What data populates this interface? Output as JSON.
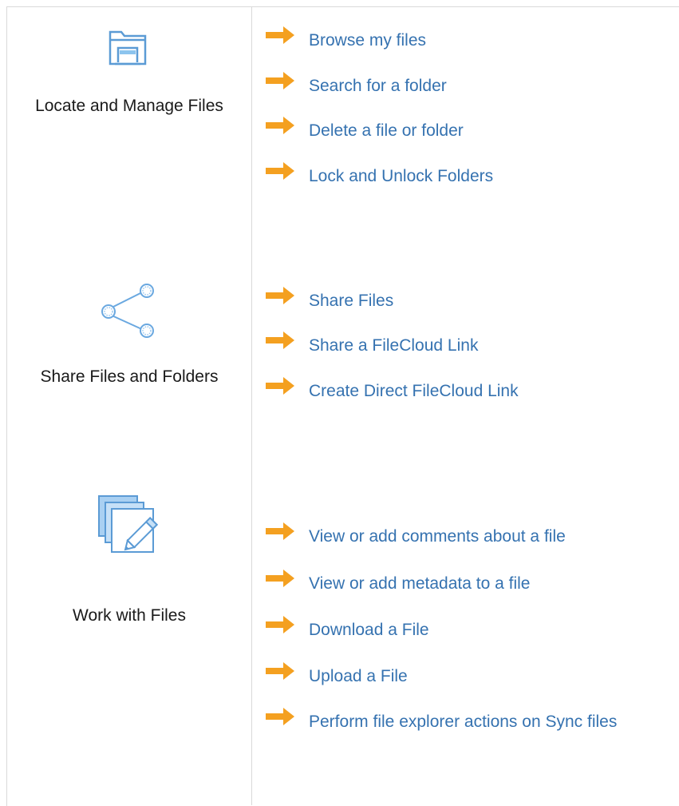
{
  "colors": {
    "link": "#3572b0",
    "arrow": "#f4a020",
    "icon": "#6aa8e0",
    "border": "#d9d9d9"
  },
  "sections": [
    {
      "title": "Locate and Manage Files",
      "icon": "folder-icon",
      "links": [
        "Browse my files",
        "Search for a folder",
        "Delete a file or folder",
        "Lock and Unlock Folders"
      ]
    },
    {
      "title": "Share Files and Folders",
      "icon": "share-icon",
      "links": [
        "Share Files",
        "Share a FileCloud Link",
        "Create Direct FileCloud Link"
      ]
    },
    {
      "title": "Work with Files",
      "icon": "edit-files-icon",
      "links": [
        "View or add comments about a file",
        "View or add metadata to a file",
        "Download a File",
        "Upload a File",
        "Perform file explorer actions on Sync files"
      ]
    }
  ]
}
